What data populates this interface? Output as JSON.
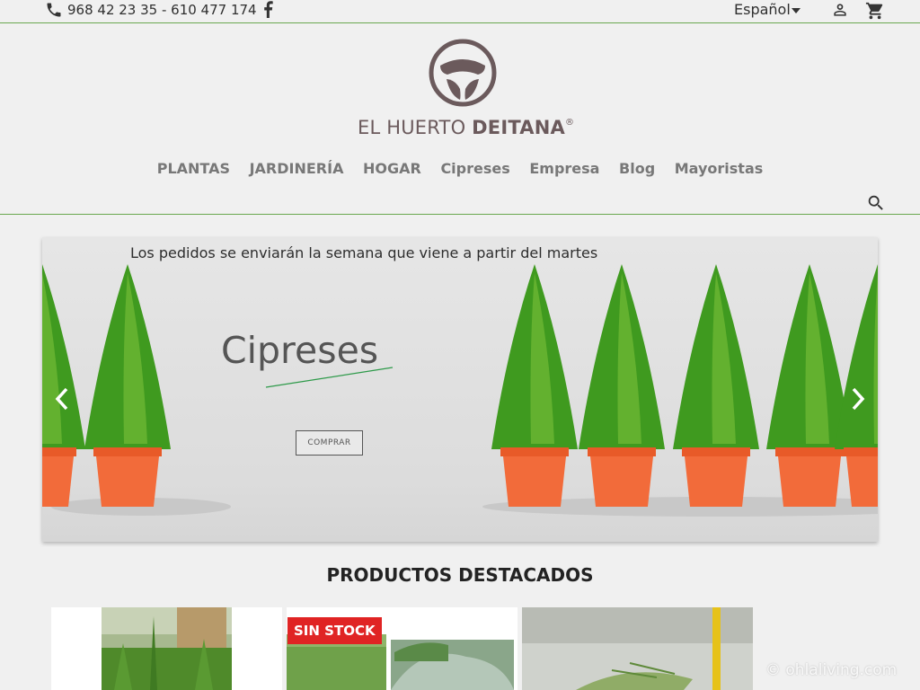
{
  "topbar": {
    "phone": "968 42 23 35 - 610 477 174",
    "language": "Español",
    "icons": [
      "phone-icon",
      "facebook-icon",
      "chevron-down-icon",
      "user-icon",
      "cart-icon"
    ]
  },
  "brand": {
    "name_light": "EL HUERTO ",
    "name_bold": "DEITANA",
    "registered": "®",
    "color": "#6b5a5c"
  },
  "nav": {
    "items": [
      "PLANTAS",
      "JARDINERÍA",
      "HOGAR",
      "Cipreses",
      "Empresa",
      "Blog",
      "Mayoristas"
    ]
  },
  "banner": {
    "notice": "Los pedidos se enviarán la semana que viene a partir del martes",
    "heading": "Cipreses",
    "button": "COMPRAR"
  },
  "products": {
    "title": "PRODUCTOS DESTACADOS",
    "badge": "SIN STOCK"
  },
  "watermark": "© ohlaliving.com",
  "colors": {
    "accent": "#6aa84f",
    "badge": "#e02424",
    "pot": "#f26b3a",
    "tree": "#3f9a1f"
  }
}
